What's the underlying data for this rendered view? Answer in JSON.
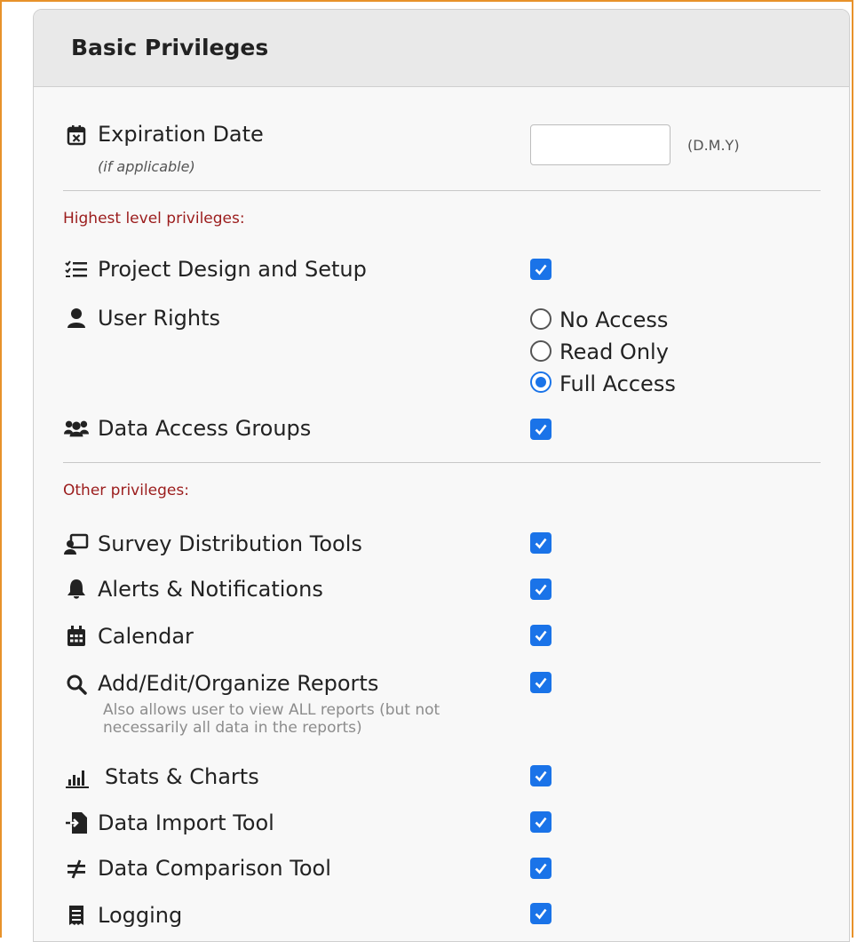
{
  "panel": {
    "title": "Basic Privileges"
  },
  "expiration": {
    "label": "Expiration Date",
    "sublabel": "(if applicable)",
    "input_value": "",
    "format_hint": "(D.M.Y)"
  },
  "sections": {
    "highest": "Highest level privileges:",
    "other": "Other privileges:"
  },
  "highest_items": {
    "project_design": {
      "label": "Project Design and Setup",
      "checked": true,
      "icon": "list-check-icon"
    },
    "user_rights": {
      "label": "User Rights",
      "icon": "user-icon",
      "options": [
        "No Access",
        "Read Only",
        "Full Access"
      ],
      "selected": "Full Access"
    },
    "data_access_groups": {
      "label": "Data Access Groups",
      "checked": true,
      "icon": "users-group-icon"
    }
  },
  "other_items": {
    "survey": {
      "label": "Survey Distribution Tools",
      "checked": true,
      "icon": "chalkboard-user-icon"
    },
    "alerts": {
      "label": "Alerts & Notifications",
      "checked": true,
      "icon": "bell-icon"
    },
    "calendar": {
      "label": "Calendar",
      "checked": true,
      "icon": "calendar-icon"
    },
    "reports": {
      "label": "Add/Edit/Organize Reports",
      "note_line1": "Also allows user to view ALL reports (but not",
      "note_line2": "necessarily all data in the reports)",
      "checked": true,
      "icon": "search-icon"
    },
    "stats": {
      "label": "Stats & Charts",
      "checked": true,
      "icon": "bar-chart-icon"
    },
    "import": {
      "label": "Data Import Tool",
      "checked": true,
      "icon": "file-import-icon"
    },
    "comparison": {
      "label": "Data Comparison Tool",
      "checked": true,
      "icon": "not-equal-icon"
    },
    "logging": {
      "label": "Logging",
      "checked": true,
      "icon": "receipt-icon"
    }
  },
  "colors": {
    "accent": "#1a73e8",
    "section_heading": "#9b1c1c",
    "frame": "#e8922a"
  }
}
